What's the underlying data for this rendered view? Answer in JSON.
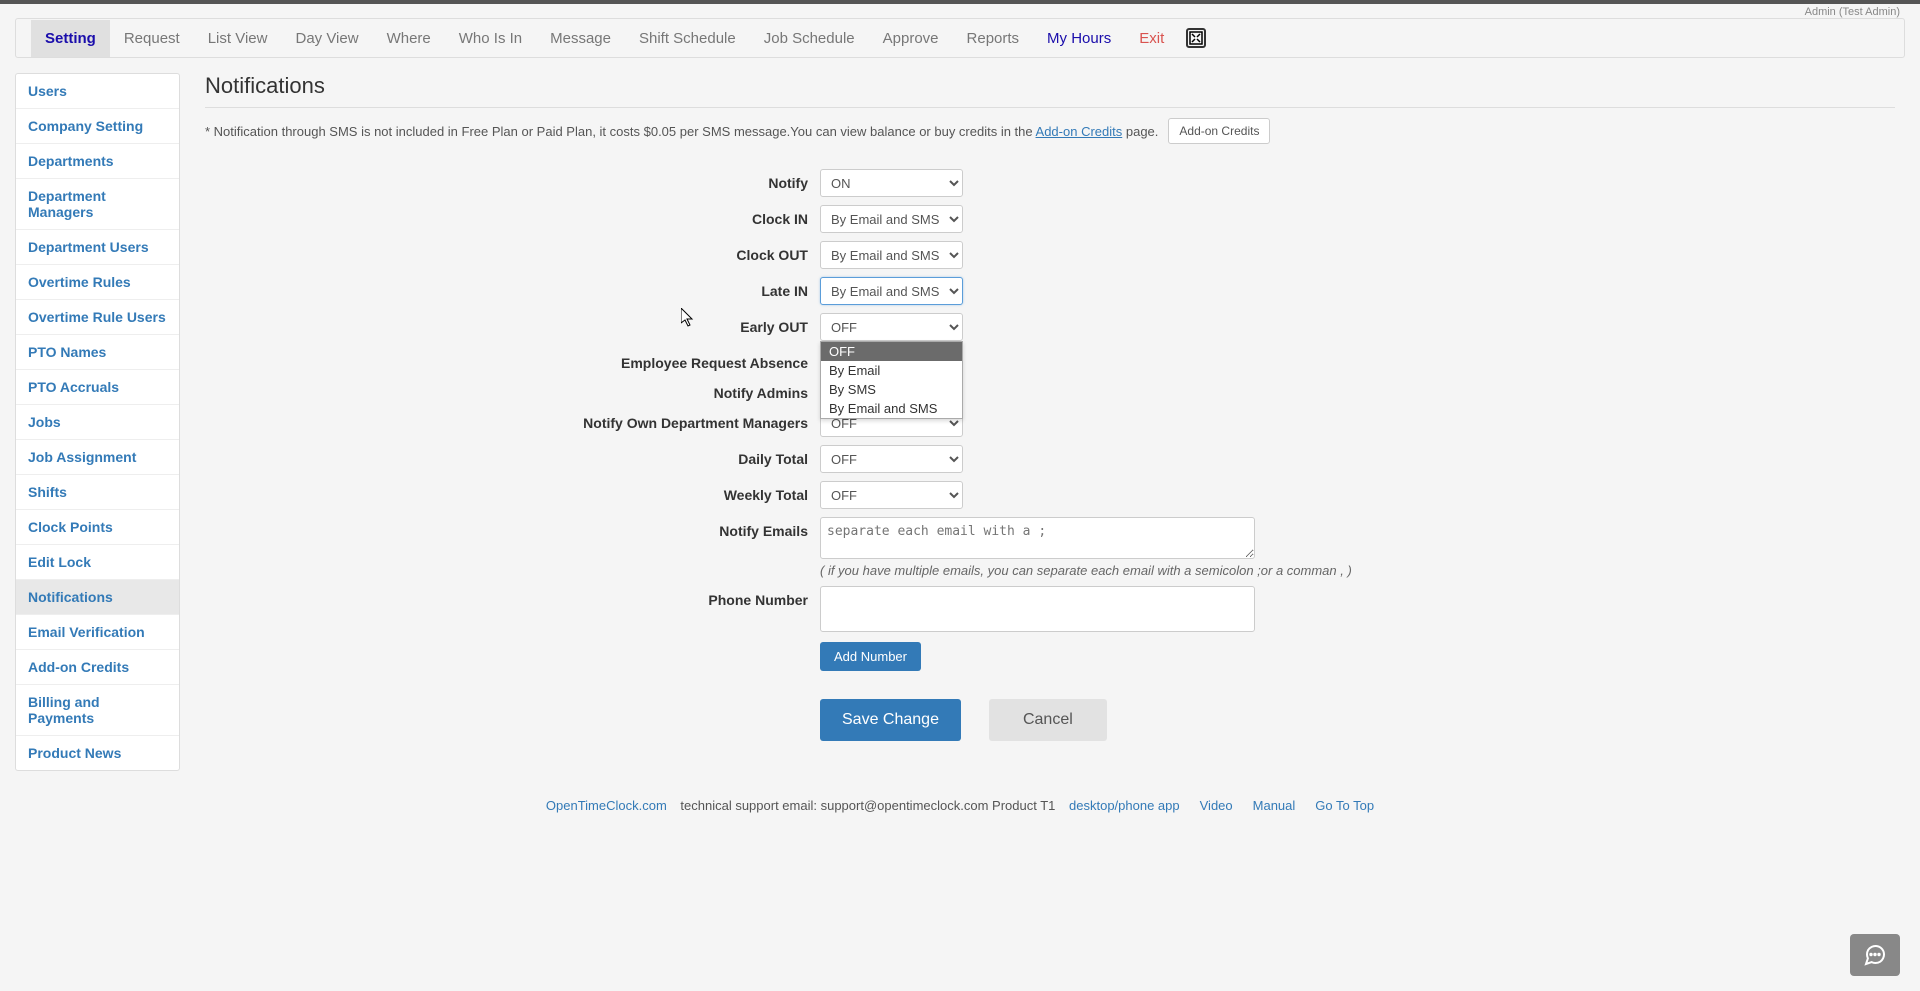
{
  "user_info": "Admin (Test Admin)",
  "nav": [
    {
      "label": "Setting",
      "cls": "active"
    },
    {
      "label": "Request"
    },
    {
      "label": "List View"
    },
    {
      "label": "Day View"
    },
    {
      "label": "Where"
    },
    {
      "label": "Who Is In"
    },
    {
      "label": "Message"
    },
    {
      "label": "Shift Schedule"
    },
    {
      "label": "Job Schedule"
    },
    {
      "label": "Approve"
    },
    {
      "label": "Reports"
    },
    {
      "label": "My Hours",
      "cls": "myhours"
    },
    {
      "label": "Exit",
      "cls": "exit"
    }
  ],
  "sidebar": [
    "Users",
    "Company Setting",
    "Departments",
    "Department Managers",
    "Department Users",
    "Overtime Rules",
    "Overtime Rule Users",
    "PTO Names",
    "PTO Accruals",
    "Jobs",
    "Job Assignment",
    "Shifts",
    "Clock Points",
    "Edit Lock",
    "Notifications",
    "Email Verification",
    "Add-on Credits",
    "Billing and Payments",
    "Product News"
  ],
  "sidebar_active": "Notifications",
  "page_title": "Notifications",
  "notice": {
    "pre": "* Notification through SMS is not included in Free Plan or Paid Plan, it costs $0.05 per SMS message.You can view balance or buy credits in the ",
    "link": "Add-on Credits",
    "post": " page.",
    "button": "Add-on Credits"
  },
  "form": {
    "notify": {
      "label": "Notify",
      "value": "ON"
    },
    "clock_in": {
      "label": "Clock IN",
      "value": "By Email and SMS"
    },
    "clock_out": {
      "label": "Clock OUT",
      "value": "By Email and SMS"
    },
    "late_in": {
      "label": "Late IN",
      "value": "By Email and SMS"
    },
    "early_out": {
      "label": "Early OUT",
      "value": "OFF"
    },
    "emp_req_absence": {
      "label": "Employee Request Absence"
    },
    "notify_admins": {
      "label": "Notify Admins"
    },
    "notify_own_dept": {
      "label": "Notify Own Department Managers",
      "value": "OFF"
    },
    "daily_total": {
      "label": "Daily Total",
      "value": "OFF"
    },
    "weekly_total": {
      "label": "Weekly Total",
      "value": "OFF"
    },
    "notify_emails": {
      "label": "Notify Emails",
      "placeholder": "separate each email with a ;",
      "hint": "( if you have multiple emails, you can separate each email with a semicolon ;or a comman , )"
    },
    "phone_number": {
      "label": "Phone Number",
      "button": "Add Number"
    },
    "save": "Save Change",
    "cancel": "Cancel"
  },
  "dropdown_options": [
    "OFF",
    "By Email",
    "By SMS",
    "By Email and SMS"
  ],
  "footer": {
    "brand": "OpenTimeClock.com",
    "support": " technical support email: support@opentimeclock.com Product T1",
    "links": [
      "desktop/phone app",
      "Video",
      "Manual",
      "Go To Top"
    ]
  }
}
